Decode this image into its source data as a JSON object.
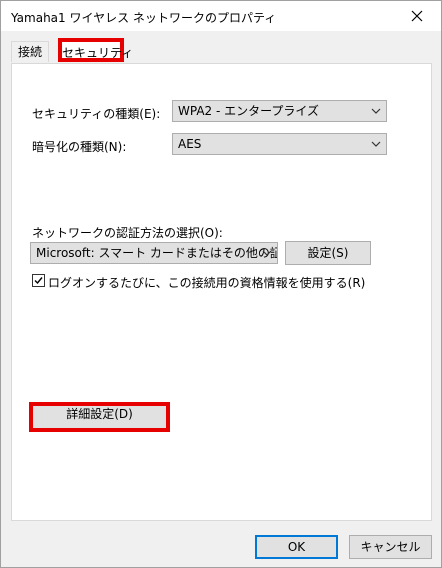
{
  "window": {
    "title": "Yamaha1 ワイヤレス ネットワークのプロパティ"
  },
  "tabs": [
    {
      "label": "接続"
    },
    {
      "label": "セキュリティ"
    }
  ],
  "security": {
    "security_type_label": "セキュリティの種類(E):",
    "security_type_value": "WPA2 - エンタープライズ",
    "encryption_label": "暗号化の種類(N):",
    "encryption_value": "AES",
    "auth_method_label": "ネットワークの認証方法の選択(O):",
    "auth_method_value": "Microsoft: スマート カードまたはその他の証明書",
    "settings_button": "設定(S)",
    "remember_checkbox_label": "ログオンするたびに、この接続用の資格情報を使用する(R)",
    "remember_checked": true,
    "advanced_button": "詳細設定(D)"
  },
  "footer": {
    "ok_button": "OK",
    "cancel_button": "キャンセル"
  },
  "colors": {
    "highlight_red": "#e60000",
    "ok_border": "#0078d7"
  }
}
